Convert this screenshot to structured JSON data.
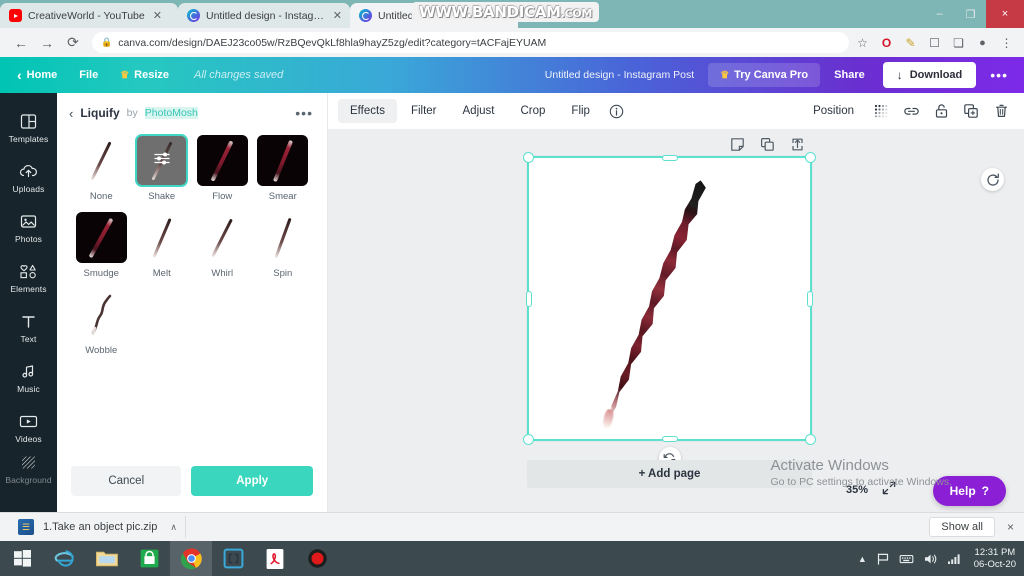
{
  "browser": {
    "tabs": [
      {
        "title": "CreativeWorld - YouTube",
        "favicon": "youtube-icon",
        "active": false
      },
      {
        "title": "Untitled design - Instagram Post",
        "favicon": "canva-icon",
        "active": false
      },
      {
        "title": "Untitled design - Instagram Post",
        "favicon": "canva-icon",
        "active": true
      }
    ],
    "window_buttons": {
      "minimize": "–",
      "maximize": "❐",
      "close": "×"
    },
    "url": "canva.com/design/DAEJ23co05w/RzBQevQkLf8hla9hayZ5zg/edit?category=tACFajEYUAM",
    "lock_icon": "lock-icon",
    "toolbar_icons": [
      "star-icon",
      "opera-icon",
      "eyedropper-icon",
      "cast-icon",
      "extensions-icon",
      "profile-icon",
      "chrome-menu-icon"
    ],
    "back_icon": "←",
    "forward_icon": "→",
    "reload_icon": "⟳"
  },
  "watermark": {
    "main": "WWW.BANDICAM",
    "suffix": ".COM"
  },
  "canva_header": {
    "back_icon": "‹",
    "home_label": "Home",
    "file_label": "File",
    "resize_label": "Resize",
    "resize_crown": "♛",
    "saved_status": "All changes saved",
    "doc_title": "Untitled design - Instagram Post",
    "pro_label": "Try Canva Pro",
    "pro_crown": "♛",
    "share_label": "Share",
    "download_label": "Download",
    "more_label": "•••"
  },
  "rail": {
    "items": [
      {
        "label": "Templates",
        "icon": "templates-icon"
      },
      {
        "label": "Uploads",
        "icon": "uploads-cloud-icon"
      },
      {
        "label": "Photos",
        "icon": "photos-icon"
      },
      {
        "label": "Elements",
        "icon": "elements-icon"
      },
      {
        "label": "Text",
        "icon": "text-icon"
      },
      {
        "label": "Music",
        "icon": "music-note-icon"
      },
      {
        "label": "Videos",
        "icon": "videos-icon"
      },
      {
        "label": "Background",
        "icon": "background-icon"
      }
    ]
  },
  "panel": {
    "back_icon": "‹",
    "title": "Liquify",
    "by_label": "by",
    "author": "PhotoMosh",
    "more_icon": "•••",
    "effects": [
      {
        "label": "None",
        "style": "light",
        "selected": false
      },
      {
        "label": "Shake",
        "style": "light",
        "selected": true
      },
      {
        "label": "Flow",
        "style": "dark",
        "selected": false
      },
      {
        "label": "Smear",
        "style": "dark",
        "selected": false
      },
      {
        "label": "Smudge",
        "style": "dark",
        "selected": false
      },
      {
        "label": "Melt",
        "style": "light",
        "selected": false
      },
      {
        "label": "Whirl",
        "style": "light",
        "selected": false
      },
      {
        "label": "Spin",
        "style": "light",
        "selected": false
      },
      {
        "label": "Wobble",
        "style": "wobble",
        "selected": false
      }
    ],
    "cancel_label": "Cancel",
    "apply_label": "Apply"
  },
  "editor_toolbar": {
    "tabs": [
      "Effects",
      "Filter",
      "Adjust",
      "Crop",
      "Flip"
    ],
    "active_tab": "Effects",
    "info_icon": "info-icon",
    "position_label": "Position",
    "right_icons": [
      "transparency-icon",
      "link-icon",
      "lock-icon",
      "duplicate-icon",
      "trash-icon"
    ]
  },
  "canvas": {
    "page_tools": [
      "notes-icon",
      "duplicate-page-icon",
      "export-page-icon"
    ],
    "rotate_icon": "rotate-handle-icon",
    "refresh_icon": "refresh-icon",
    "add_page_label": "+ Add page",
    "zoom_level": "35%",
    "expand_icon": "expand-icon",
    "help_label": "Help",
    "help_mark": "?"
  },
  "activate_windows": {
    "title": "Activate Windows",
    "subtitle": "Go to PC settings to activate Windows."
  },
  "downloads": {
    "file_name": "1.Take an object pic.zip",
    "file_icon": "zip-file-icon",
    "caret_icon": "∧",
    "show_all_label": "Show all",
    "close_icon": "×"
  },
  "taskbar": {
    "start_icon": "windows-start-icon",
    "apps": [
      {
        "name": "internet-explorer-icon"
      },
      {
        "name": "file-explorer-icon"
      },
      {
        "name": "microsoft-store-icon"
      },
      {
        "name": "google-chrome-icon",
        "active": true
      },
      {
        "name": "brackets-icon"
      },
      {
        "name": "adobe-reader-icon"
      },
      {
        "name": "bandicam-icon"
      }
    ],
    "tray_icons": [
      "show-hidden-icons",
      "flag-icon",
      "keyboard-icon",
      "volume-icon",
      "network-icon"
    ],
    "time": "12:31 PM",
    "date": "06-Oct-20"
  }
}
